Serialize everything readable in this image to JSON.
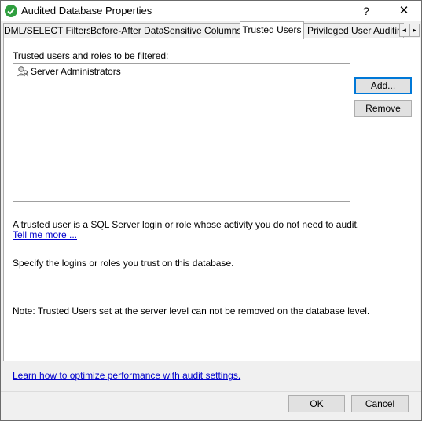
{
  "window": {
    "title": "Audited Database Properties"
  },
  "titlebar": {
    "help_glyph": "?",
    "close_glyph": "✕"
  },
  "tabs": [
    {
      "label": "DML/SELECT Filters"
    },
    {
      "label": "Before-After Data"
    },
    {
      "label": "Sensitive Columns"
    },
    {
      "label": "Trusted Users"
    },
    {
      "label": "Privileged User Auditing"
    }
  ],
  "tab_scroll": {
    "left_glyph": "◄",
    "right_glyph": "►"
  },
  "trusted": {
    "list_label": "Trusted users and roles to be filtered:",
    "items": [
      {
        "label": "Server Administrators",
        "icon": "user-key-icon"
      }
    ],
    "add_label": "Add...",
    "remove_label": "Remove",
    "description": "A trusted user is a SQL Server login or role whose activity you do not need to audit.",
    "tell_me_more": "Tell me more ...",
    "specify_text": "Specify the logins or roles you trust on this database.",
    "note_text": "Note: Trusted Users set at the server level can not be removed on the database level."
  },
  "footer": {
    "optimize_link": "Learn how to optimize performance with audit settings.",
    "ok_label": "OK",
    "cancel_label": "Cancel"
  },
  "colors": {
    "accent": "#0078d7",
    "link": "#0000cc",
    "check": "#2e9e3e"
  }
}
